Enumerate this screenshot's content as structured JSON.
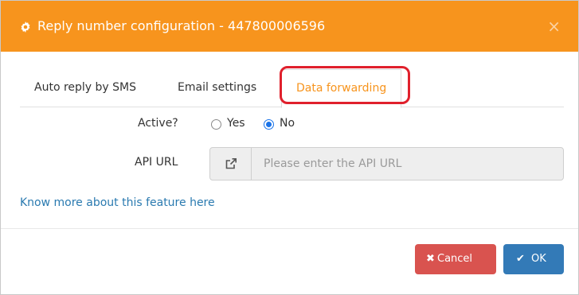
{
  "header": {
    "title": "Reply number configuration - 447800006596",
    "icon": "gear-icon",
    "close_label": "×",
    "background": "#f7941d"
  },
  "tabs": [
    {
      "label": "Auto reply by SMS",
      "active": false
    },
    {
      "label": "Email settings",
      "active": false
    },
    {
      "label": "Data forwarding",
      "active": true
    }
  ],
  "form": {
    "active_label": "Active?",
    "options": [
      {
        "label": "Yes",
        "selected": false
      },
      {
        "label": "No",
        "selected": true
      }
    ],
    "api_url_label": "API URL",
    "api_url_value": "",
    "api_url_placeholder": "Please enter the API URL"
  },
  "link": {
    "text": "Know more about this feature here"
  },
  "footer": {
    "cancel_label": "Cancel",
    "cancel_icon": "✖",
    "ok_label": "OK",
    "ok_icon": "✔"
  },
  "colors": {
    "accent": "#f7941d",
    "highlight": "#e0202c",
    "link": "#2a7ab0",
    "cancel": "#d9534f",
    "ok": "#337ab7"
  }
}
